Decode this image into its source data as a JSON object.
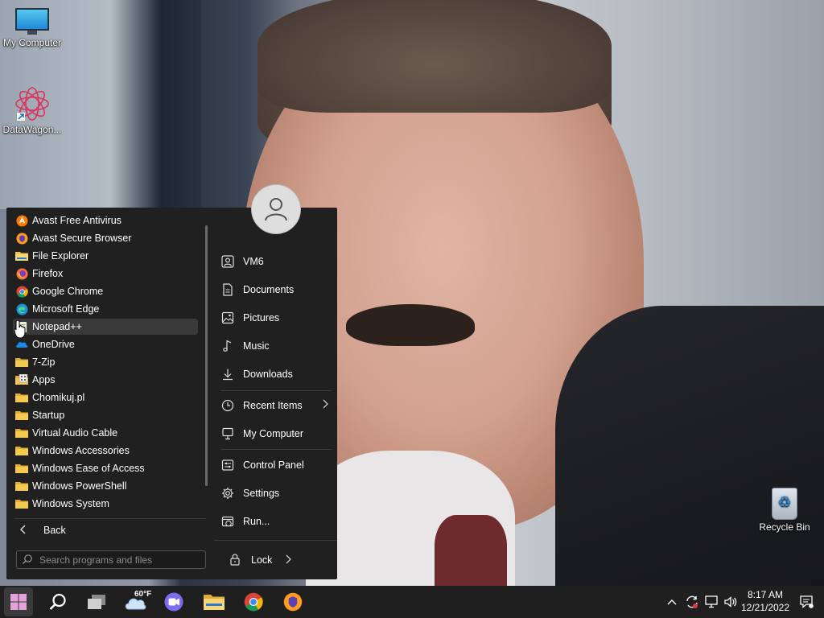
{
  "desktop": {
    "icons": [
      {
        "label": "My Computer",
        "icon": "monitor-icon"
      },
      {
        "label": "DataWagon...",
        "icon": "datawagon-icon"
      },
      {
        "label": "Recycle Bin",
        "icon": "recycle-bin-icon"
      }
    ]
  },
  "start_menu": {
    "programs": [
      {
        "label": "Avast Free Antivirus",
        "icon": "avast-icon"
      },
      {
        "label": "Avast Secure Browser",
        "icon": "avast-browser-icon"
      },
      {
        "label": "File Explorer",
        "icon": "folder-icon"
      },
      {
        "label": "Firefox",
        "icon": "firefox-icon"
      },
      {
        "label": "Google Chrome",
        "icon": "chrome-icon"
      },
      {
        "label": "Microsoft Edge",
        "icon": "edge-icon"
      },
      {
        "label": "Notepad++",
        "icon": "notepad-plus-plus-icon"
      },
      {
        "label": "OneDrive",
        "icon": "onedrive-icon"
      },
      {
        "label": "7-Zip",
        "icon": "folder-icon"
      },
      {
        "label": "Apps",
        "icon": "apps-icon"
      },
      {
        "label": "Chomikuj.pl",
        "icon": "folder-icon"
      },
      {
        "label": "Startup",
        "icon": "folder-icon"
      },
      {
        "label": "Virtual Audio Cable",
        "icon": "folder-icon"
      },
      {
        "label": "Windows Accessories",
        "icon": "folder-icon"
      },
      {
        "label": "Windows Ease of Access",
        "icon": "folder-icon"
      },
      {
        "label": "Windows PowerShell",
        "icon": "folder-icon"
      },
      {
        "label": "Windows System",
        "icon": "folder-icon"
      }
    ],
    "back_label": "Back",
    "search_placeholder": "Search programs and files",
    "places": [
      {
        "label": "VM6",
        "icon": "user-folder-icon"
      },
      {
        "label": "Documents",
        "icon": "document-icon"
      },
      {
        "label": "Pictures",
        "icon": "picture-icon"
      },
      {
        "label": "Music",
        "icon": "music-icon"
      },
      {
        "label": "Downloads",
        "icon": "download-icon"
      },
      {
        "label": "Recent Items",
        "icon": "clock-icon"
      },
      {
        "label": "My Computer",
        "icon": "computer-icon"
      },
      {
        "label": "Control Panel",
        "icon": "control-panel-icon"
      },
      {
        "label": "Settings",
        "icon": "gear-icon"
      },
      {
        "label": "Run...",
        "icon": "run-icon"
      }
    ],
    "lock_label": "Lock"
  },
  "taskbar": {
    "weather_temp": "60°F",
    "clock_time": "8:17 AM",
    "clock_date": "12/21/2022"
  },
  "colors": {
    "menu_bg": "#202020",
    "taskbar_bg": "#1f1f1f",
    "hover_bg": "#3a3a3a",
    "folder_yellow": "#f2c14e",
    "start_accent": "#e3a3d8"
  }
}
